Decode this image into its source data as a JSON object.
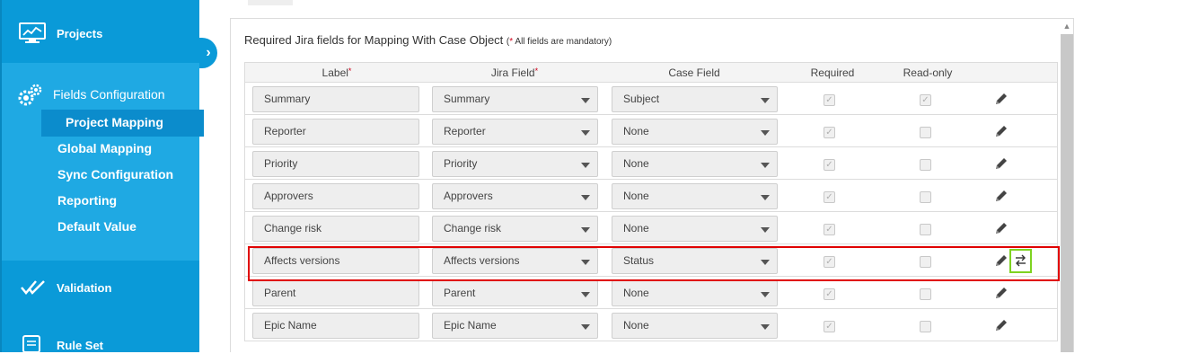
{
  "sidebar": {
    "projects_label": "Projects",
    "fields_configuration_label": "Fields Configuration",
    "sub_items": [
      "Project Mapping",
      "Global Mapping",
      "Sync Configuration",
      "Reporting",
      "Default Value"
    ],
    "validation_label": "Validation",
    "rule_set_label": "Rule Set",
    "collapse_glyph": "›"
  },
  "section": {
    "title": "Required Jira fields for Mapping With Case Object",
    "note_star": "*",
    "note_open": "(",
    "note_text": " All fields are mandatory)"
  },
  "table": {
    "headers": {
      "label": "Label",
      "jira_field": "Jira Field",
      "case_field": "Case Field",
      "required": "Required",
      "read_only": "Read-only",
      "required_marker": "*"
    },
    "rows": [
      {
        "label": "Summary",
        "jira_field": "Summary",
        "case_field": "Subject",
        "required": true,
        "read_only": true
      },
      {
        "label": "Reporter",
        "jira_field": "Reporter",
        "case_field": "None",
        "required": true,
        "read_only": false
      },
      {
        "label": "Priority",
        "jira_field": "Priority",
        "case_field": "None",
        "required": true,
        "read_only": false
      },
      {
        "label": "Approvers",
        "jira_field": "Approvers",
        "case_field": "None",
        "required": true,
        "read_only": false
      },
      {
        "label": "Change risk",
        "jira_field": "Change risk",
        "case_field": "None",
        "required": true,
        "read_only": false
      },
      {
        "label": "Affects versions",
        "jira_field": "Affects versions",
        "case_field": "Status",
        "required": true,
        "read_only": false
      },
      {
        "label": "Parent",
        "jira_field": "Parent",
        "case_field": "None",
        "required": true,
        "read_only": false
      },
      {
        "label": "Epic Name",
        "jira_field": "Epic Name",
        "case_field": "None",
        "required": true,
        "read_only": false
      }
    ]
  },
  "colors": {
    "sidebar_bg": "#0a9ad8",
    "sidebar_section_bg": "#1fa9e3",
    "active_item_bg": "#0b8ccc",
    "highlight_border": "#e00000",
    "sync_button_border": "#7ed321"
  },
  "icons": {
    "projects": "monitor-chart-icon",
    "fields_configuration": "gears-icon",
    "validation": "double-check-icon",
    "rule_set": "scroll-icon",
    "edit": "pencil-icon",
    "sync": "swap-arrows-icon"
  }
}
